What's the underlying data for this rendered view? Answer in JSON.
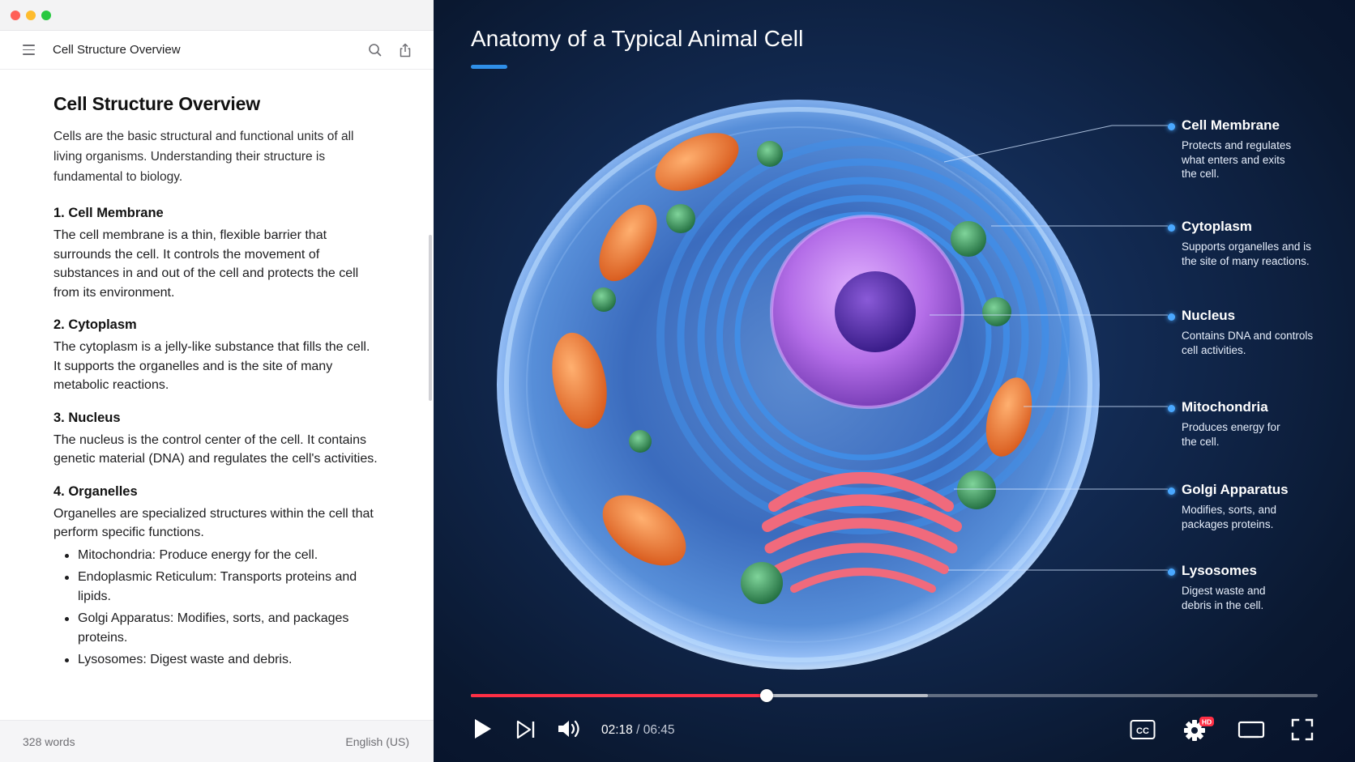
{
  "document": {
    "toolbar_title": "Cell Structure Overview",
    "title": "Cell Structure Overview",
    "intro": "Cells are the basic structural and functional units of all living organisms. Understanding their structure is fundamental to biology.",
    "sections": [
      {
        "heading": "1. Cell Membrane",
        "body": "The cell membrane is a thin, flexible barrier that surrounds the cell. It controls the movement of substances in and out of the cell and protects the cell from its environment."
      },
      {
        "heading": "2. Cytoplasm",
        "body": "The cytoplasm is a jelly-like substance that fills the cell. It supports the organelles and is the site of many metabolic reactions."
      },
      {
        "heading": "3. Nucleus",
        "body": "The nucleus is the control center of the cell. It contains genetic material (DNA) and regulates the cell's activities."
      },
      {
        "heading": "4. Organelles",
        "body": "Organelles are specialized structures within the cell that perform specific functions."
      }
    ],
    "organelles": [
      {
        "term": "Mitochondria:",
        "desc": " Produce energy for the cell."
      },
      {
        "term": "Endoplasmic Reticulum:",
        "desc": " Transports proteins and lipids."
      },
      {
        "term": "Golgi Apparatus:",
        "desc": " Modifies, sorts, and packages proteins."
      },
      {
        "term": "Lysosomes:",
        "desc": " Digest waste and debris."
      }
    ],
    "word_count": "328 words",
    "language": "English (US)"
  },
  "video": {
    "title": "Anatomy of a Typical Animal Cell",
    "labels": [
      {
        "title": "Cell Membrane",
        "desc": "Protects and regulates what enters and exits the cell."
      },
      {
        "title": "Cytoplasm",
        "desc": "Supports organelles and is the site of many reactions."
      },
      {
        "title": "Nucleus",
        "desc": "Contains DNA and controls cell activities."
      },
      {
        "title": "Mitochondria",
        "desc": "Produces energy for the cell."
      },
      {
        "title": "Golgi Apparatus",
        "desc": "Modifies, sorts, and packages proteins."
      },
      {
        "title": "Lysosomes",
        "desc": "Digest waste and debris in the cell."
      }
    ],
    "current_time": "02:18",
    "separator": " / ",
    "duration": "06:45",
    "progress_fraction": 0.349,
    "buffered_fraction": 0.54,
    "hd_badge": "HD",
    "cc_label": "CC",
    "accent_color": "#ff2f45"
  }
}
